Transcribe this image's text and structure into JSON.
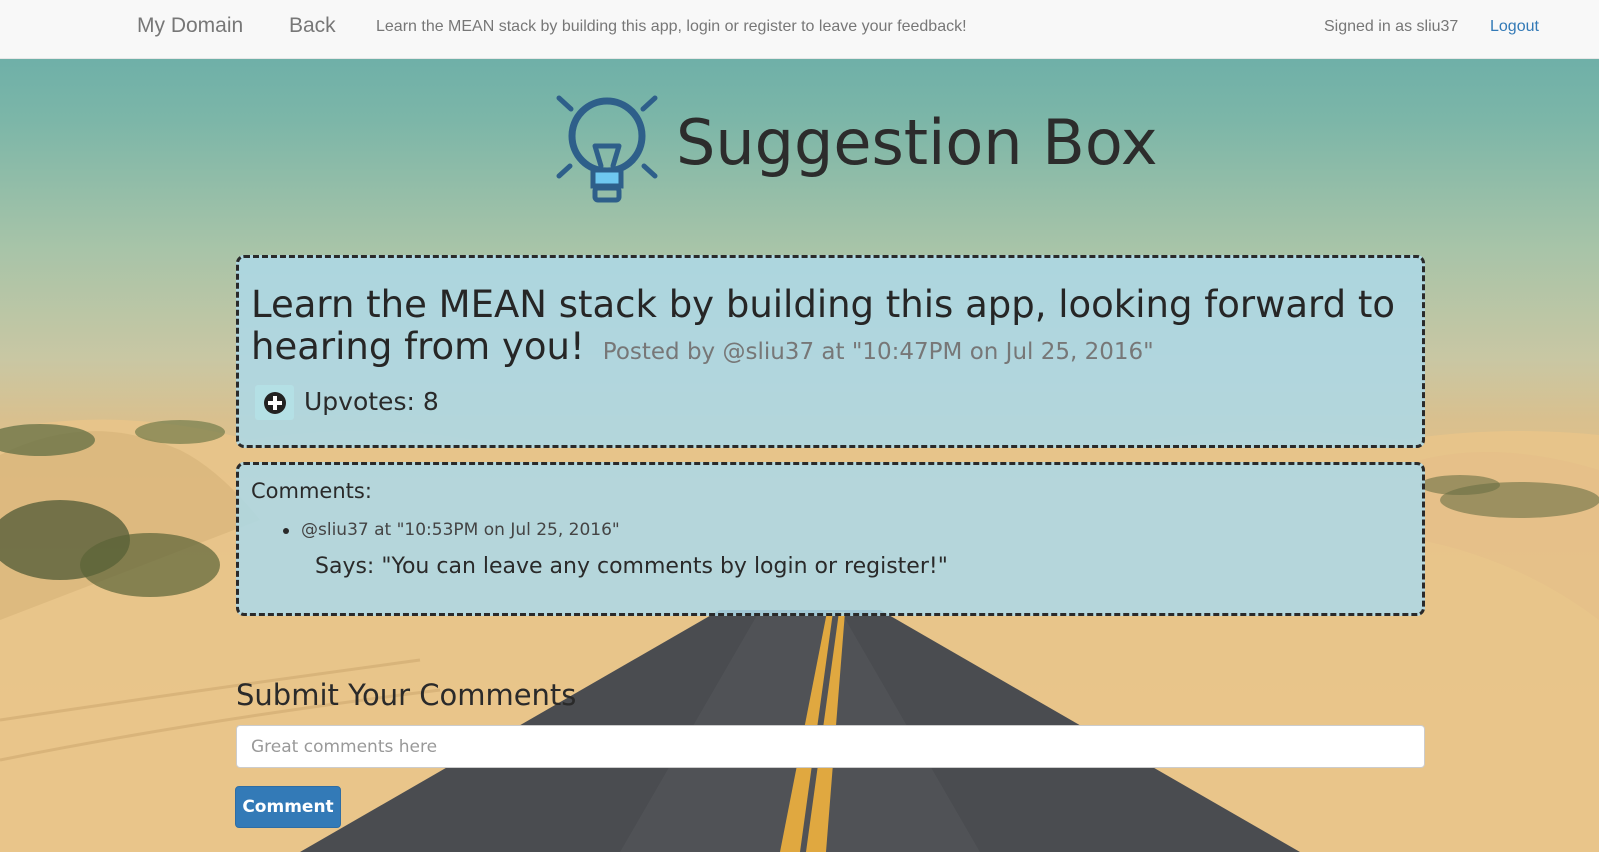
{
  "navbar": {
    "brand": "My Domain",
    "back": "Back",
    "tagline": "Learn the MEAN stack by building this app, login or register to leave your feedback!",
    "signed_in": "Signed in as sliu37",
    "logout": "Logout"
  },
  "header": {
    "title": "Suggestion Box",
    "icon": "lightbulb-icon"
  },
  "post": {
    "title": "Learn the MEAN stack by building this app, looking forward to hearing from you!",
    "meta": "Posted by @sliu37 at \"10:47PM on Jul 25, 2016\"",
    "upvote_icon": "plus-circle-icon",
    "upvotes": "Upvotes: 8"
  },
  "comments": {
    "heading": "Comments:",
    "items": [
      {
        "meta": "@sliu37 at \"10:53PM on Jul 25, 2016\"",
        "body": "Says: \"You can leave any comments by login or register!\""
      }
    ]
  },
  "form": {
    "heading": "Submit Your Comments",
    "placeholder": "Great comments here",
    "button": "Comment"
  },
  "colors": {
    "accent": "#337ab7",
    "panel": "#add8e6",
    "text": "#2a2a2a"
  }
}
